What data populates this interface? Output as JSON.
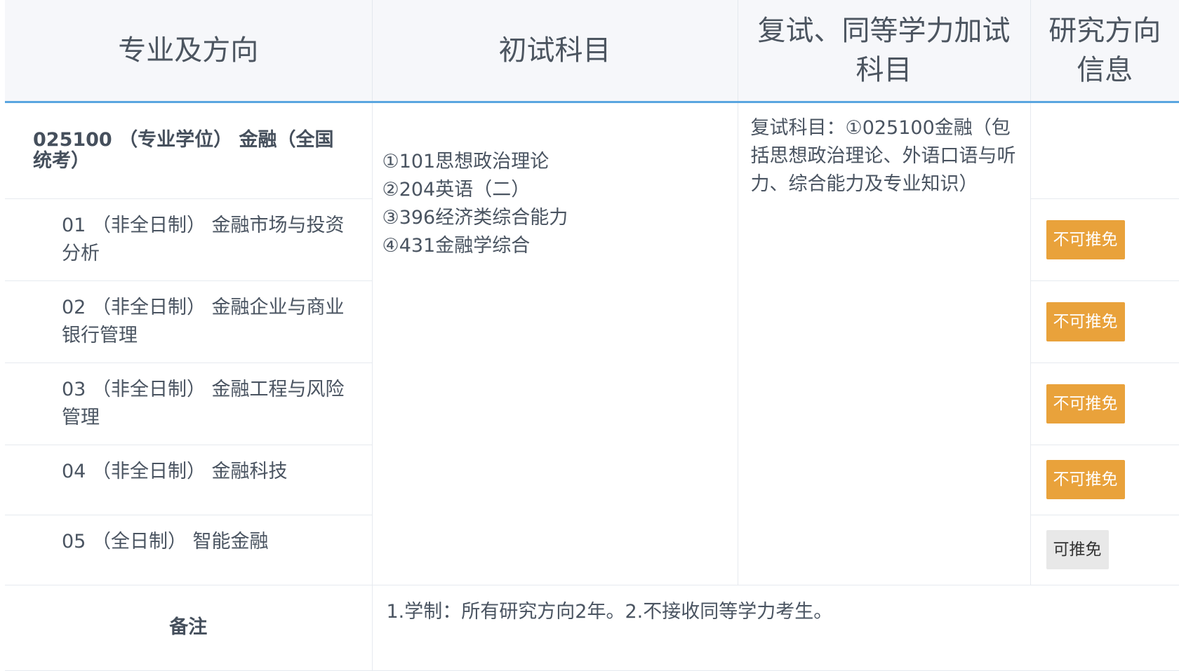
{
  "headers": {
    "major": "专业及方向",
    "initial_exam": "初试科目",
    "retest": "复试、同等学力加试科目",
    "direction_info": "研究方向信息"
  },
  "major": "025100 （专业学位） 金融（全国统考）",
  "directions": [
    {
      "label": "01 （非全日制） 金融市场与投资分析",
      "badge": "不可推免",
      "exempt": false
    },
    {
      "label": "02 （非全日制） 金融企业与商业银行管理",
      "badge": "不可推免",
      "exempt": false
    },
    {
      "label": "03 （非全日制） 金融工程与风险管理",
      "badge": "不可推免",
      "exempt": false
    },
    {
      "label": "04 （非全日制） 金融科技",
      "badge": "不可推免",
      "exempt": false
    },
    {
      "label": "05 （全日制） 智能金融",
      "badge": "可推免",
      "exempt": true
    }
  ],
  "initial_exam_subjects": [
    "①101思想政治理论",
    "②204英语（二）",
    "③396经济类综合能力",
    "④431金融学综合"
  ],
  "retest_subjects": "复试科目：①025100金融（包括思想政治理论、外语口语与听力、综合能力及专业知识）",
  "note": {
    "label": "备注",
    "text": "1.学制：所有研究方向2年。2.不接收同等学力考生。"
  },
  "colors": {
    "header_bg": "#f6f7fa",
    "header_border": "#5aa6e0",
    "badge_no_exempt": "#e9a23b",
    "badge_exempt": "#e8e8e8"
  }
}
